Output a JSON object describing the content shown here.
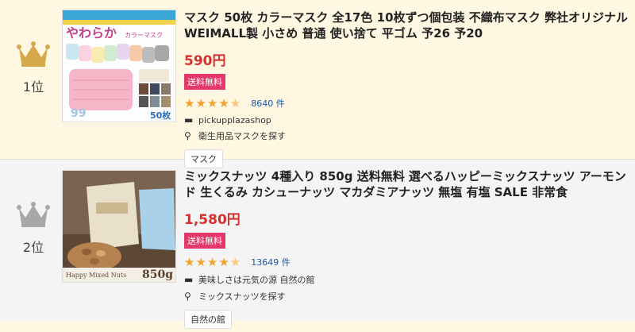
{
  "items": [
    {
      "rank_label": "1位",
      "title": "マスク 50枚 カラーマスク 全17色 10枚ずつ個包装 不織布マスク 弊社オリジナル WEIMALL製 小さめ 普通 使い捨て 平ゴム 予26 予20",
      "price": "590円",
      "shipping": "送料無料",
      "rating": 4.5,
      "review_count": "8640 件",
      "shop": "pickupplazashop",
      "search_link": "衛生用品マスクを探す",
      "tag": "マスク",
      "image": {
        "banner_text": "やわらか",
        "banner_text2": "カラーマスク",
        "badge": "50枚",
        "percent": "99"
      }
    },
    {
      "rank_label": "2位",
      "title": "ミックスナッツ 4種入り 850g 送料無料 選べるハッピーミックスナッツ アーモンド 生くるみ カシューナッツ マカダミアナッツ 無塩 有塩 SALE 非常食",
      "price": "1,580円",
      "shipping": "送料無料",
      "rating": 4.5,
      "review_count": "13649 件",
      "shop": "美味しさは元気の源 自然の館",
      "search_link": "ミックスナッツを探す",
      "tag": "自然の館",
      "image": {
        "product_name": "Happy Mixed Nuts",
        "weight": "850g"
      }
    }
  ],
  "colors": {
    "row1_bg": "#fff7e1",
    "row2_bg": "#f4f4f4",
    "price": "#d52f2f",
    "shipping_badge": "#e4386b",
    "stars": "#f0a32e",
    "link": "#1856a8",
    "crown_gold": "#d4a84b",
    "crown_silver": "#a7a7a7"
  },
  "icons": {
    "rank1": "crown-icon",
    "rank2": "crown-icon",
    "shop": "shop-icon",
    "search": "search-icon"
  }
}
